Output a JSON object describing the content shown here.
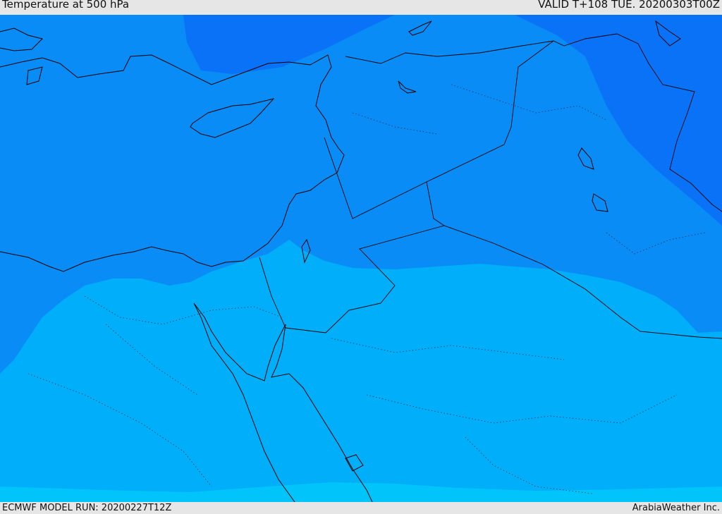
{
  "header": {
    "title": "Temperature at 500 hPa",
    "valid": "VALID T+108 TUE. 20200303T00Z"
  },
  "footer": {
    "model_run": "ECMWF MODEL RUN: 20200227T12Z",
    "credit": "ArabiaWeather Inc."
  },
  "map": {
    "field": "Temperature at 500 hPa",
    "colors": {
      "coldest": "#0a72f6",
      "cold": "#0a8cf6",
      "mild": "#00aefa",
      "warm": "#00c4fa",
      "coast_line": "#000000",
      "border_line": "#000000"
    }
  }
}
